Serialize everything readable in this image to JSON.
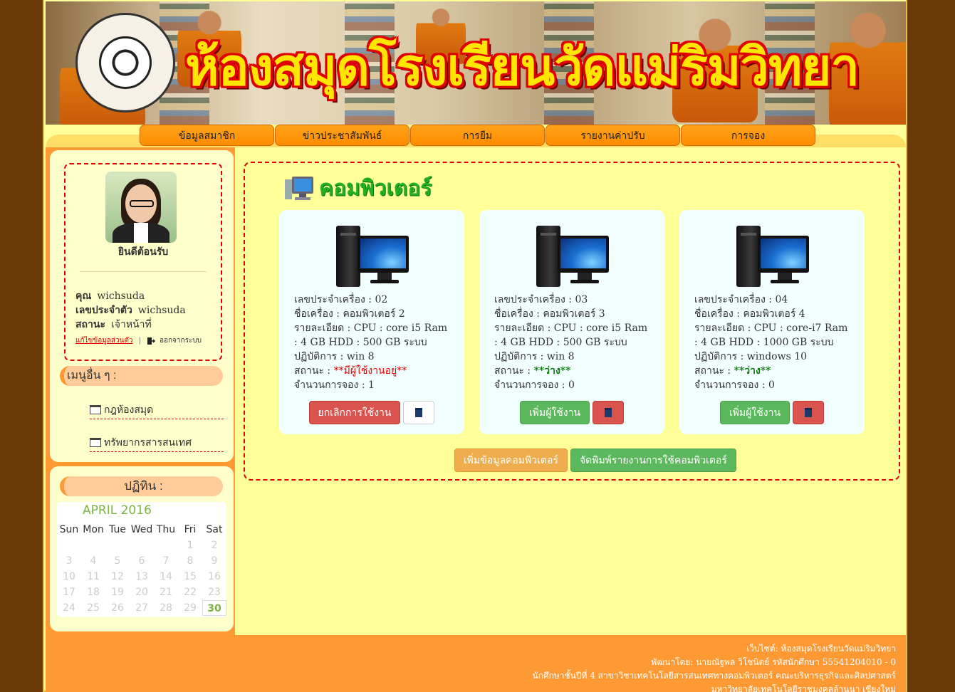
{
  "banner": {
    "title": "ห้องสมุดโรงเรียนวัดแม่ริมวิทยา",
    "title_color": "#ffe600",
    "title_outline_color": "#e00000"
  },
  "nav": {
    "items": [
      "ข้อมูลสมาชิก",
      "ข่าวประชาสัมพันธ์",
      "การยืม",
      "รายงานค่าปรับ",
      "การจอง"
    ]
  },
  "profile": {
    "welcome": "ยินดีต้อนรับ",
    "name_label": "คุณ",
    "name_value": "wichsuda",
    "id_label": "เลขประจำตัว",
    "id_value": "wichsuda",
    "status_label": "สถานะ",
    "status_value": "เจ้าหน้าที่",
    "edit_link": "แก้ไขข้อมูลส่วนตัว",
    "separator": "|",
    "logout": "ออกจากระบบ"
  },
  "menu": {
    "heading": "เมนูอื่น ๆ :",
    "items": [
      "กฎห้องสมุด",
      "ทรัพยากรสารสนเทศ"
    ]
  },
  "calendar": {
    "heading": "ปฏิทิน :",
    "month": "APRIL 2016",
    "weekdays": [
      "Sun",
      "Mon",
      "Tue",
      "Wed",
      "Thu",
      "Fri",
      "Sat"
    ],
    "weeks": [
      [
        "",
        "",
        "",
        "",
        "",
        "1",
        "2"
      ],
      [
        "3",
        "4",
        "5",
        "6",
        "7",
        "8",
        "9"
      ],
      [
        "10",
        "11",
        "12",
        "13",
        "14",
        "15",
        "16"
      ],
      [
        "17",
        "18",
        "19",
        "20",
        "21",
        "22",
        "23"
      ],
      [
        "24",
        "25",
        "26",
        "27",
        "28",
        "29",
        "30"
      ]
    ],
    "today": "30"
  },
  "main": {
    "section_title": "คอมพิวเตอร์",
    "computers": [
      {
        "machine_no": "เลขประจำเครื่อง : 02",
        "name": "ชื่อเครื่อง : คอมพิวเตอร์ 2",
        "detail": "รายละเอียด : CPU : core i5 Ram : 4 GB HDD : 500 GB ระบบปฏิบัติการ : win 8",
        "status_label": "สถานะ : ",
        "status_value": "**มีผู้ใช้งานอยู่**",
        "bookings": "จำนวนการจอง : 1",
        "action_label": "ยกเลิกการใช้งาน"
      },
      {
        "machine_no": "เลขประจำเครื่อง : 03",
        "name": "ชื่อเครื่อง : คอมพิวเตอร์ 3",
        "detail": "รายละเอียด : CPU : core i5 Ram : 4 GB HDD : 500 GB ระบบปฏิบัติการ : win 8",
        "status_label": "สถานะ : ",
        "status_value": "**ว่าง**",
        "bookings": "จำนวนการจอง : 0",
        "action_label": "เพิ่มผู้ใช้งาน"
      },
      {
        "machine_no": "เลขประจำเครื่อง : 04",
        "name": "ชื่อเครื่อง : คอมพิวเตอร์ 4",
        "detail": "รายละเอียด : CPU : core-i7 Ram : 4 GB HDD : 1000 GB ระบบปฏิบัติการ : windows 10",
        "status_label": "สถานะ : ",
        "status_value": "**ว่าง**",
        "bookings": "จำนวนการจอง : 0",
        "action_label": "เพิ่มผู้ใช้งาน"
      }
    ],
    "add_button": "เพิ่มข้อมูลคอมพิวเตอร์",
    "print_button": "จัดพิมพ์รายงานการใช้คอมพิวเตอร์"
  },
  "footer": {
    "lines": [
      "เว็บไซต์: ห้องสมุดโรงเรียนวัดแม่ริมวิทยา",
      "พัฒนาโดย: นายณัฐพล วิโชนิตย์ รหัสนักศึกษา 55541204010 - 0",
      "นักศึกษาชั้นปีที่ 4 สาขาวิชาเทคโนโลยีสารสนเทศทางคอมพิวเตอร์ คณะบริหารธุรกิจและศิลปศาสตร์",
      "มหาวิทยาลัยเทคโนโลยีราชมงคลล้านนา เชียงใหม่"
    ]
  },
  "colors": {
    "page_bg": "#6b3a08",
    "content_bg": "#ffff99",
    "accent_orange": "#ff9933",
    "danger": "#d9534f",
    "success": "#5cb85c",
    "warning": "#f0ad4e"
  }
}
